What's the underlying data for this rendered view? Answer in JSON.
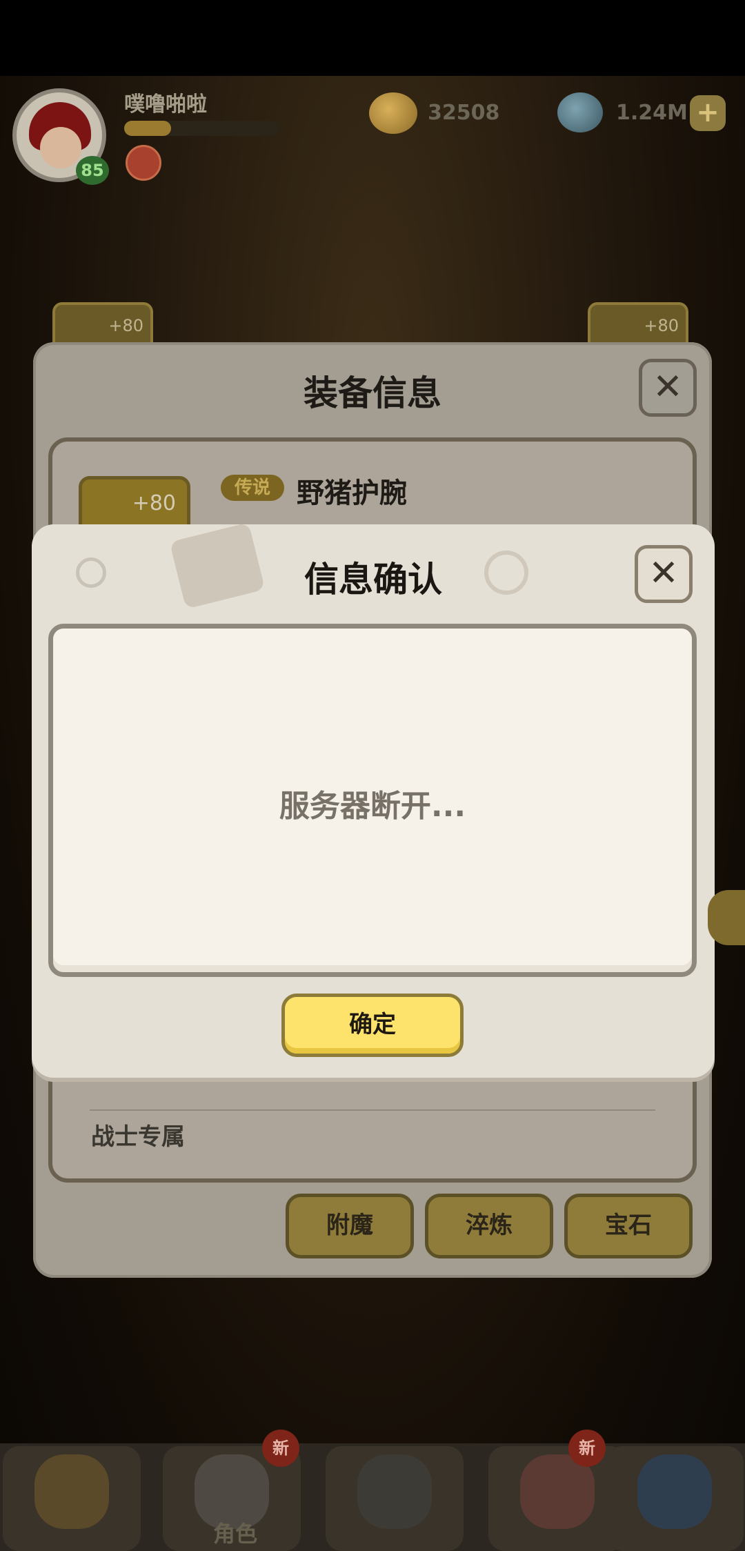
{
  "hud": {
    "player_name": "噗噜啪啦",
    "level": "85",
    "gold": "32508",
    "gems": "1.24M"
  },
  "equip_frames": {
    "left": "+80",
    "right": "+80"
  },
  "equipment_panel": {
    "title": "装备信息",
    "item_enhance": "+80",
    "rarity": "传说",
    "item_name": "野猪护腕",
    "exclusive": "战士专属",
    "actions": [
      "附魔",
      "淬炼",
      "宝石"
    ]
  },
  "dialog": {
    "title": "信息确认",
    "message": "服务器断开...",
    "confirm_label": "确定"
  },
  "bottom_nav": {
    "badge_new": "新",
    "role_label": "角色"
  }
}
